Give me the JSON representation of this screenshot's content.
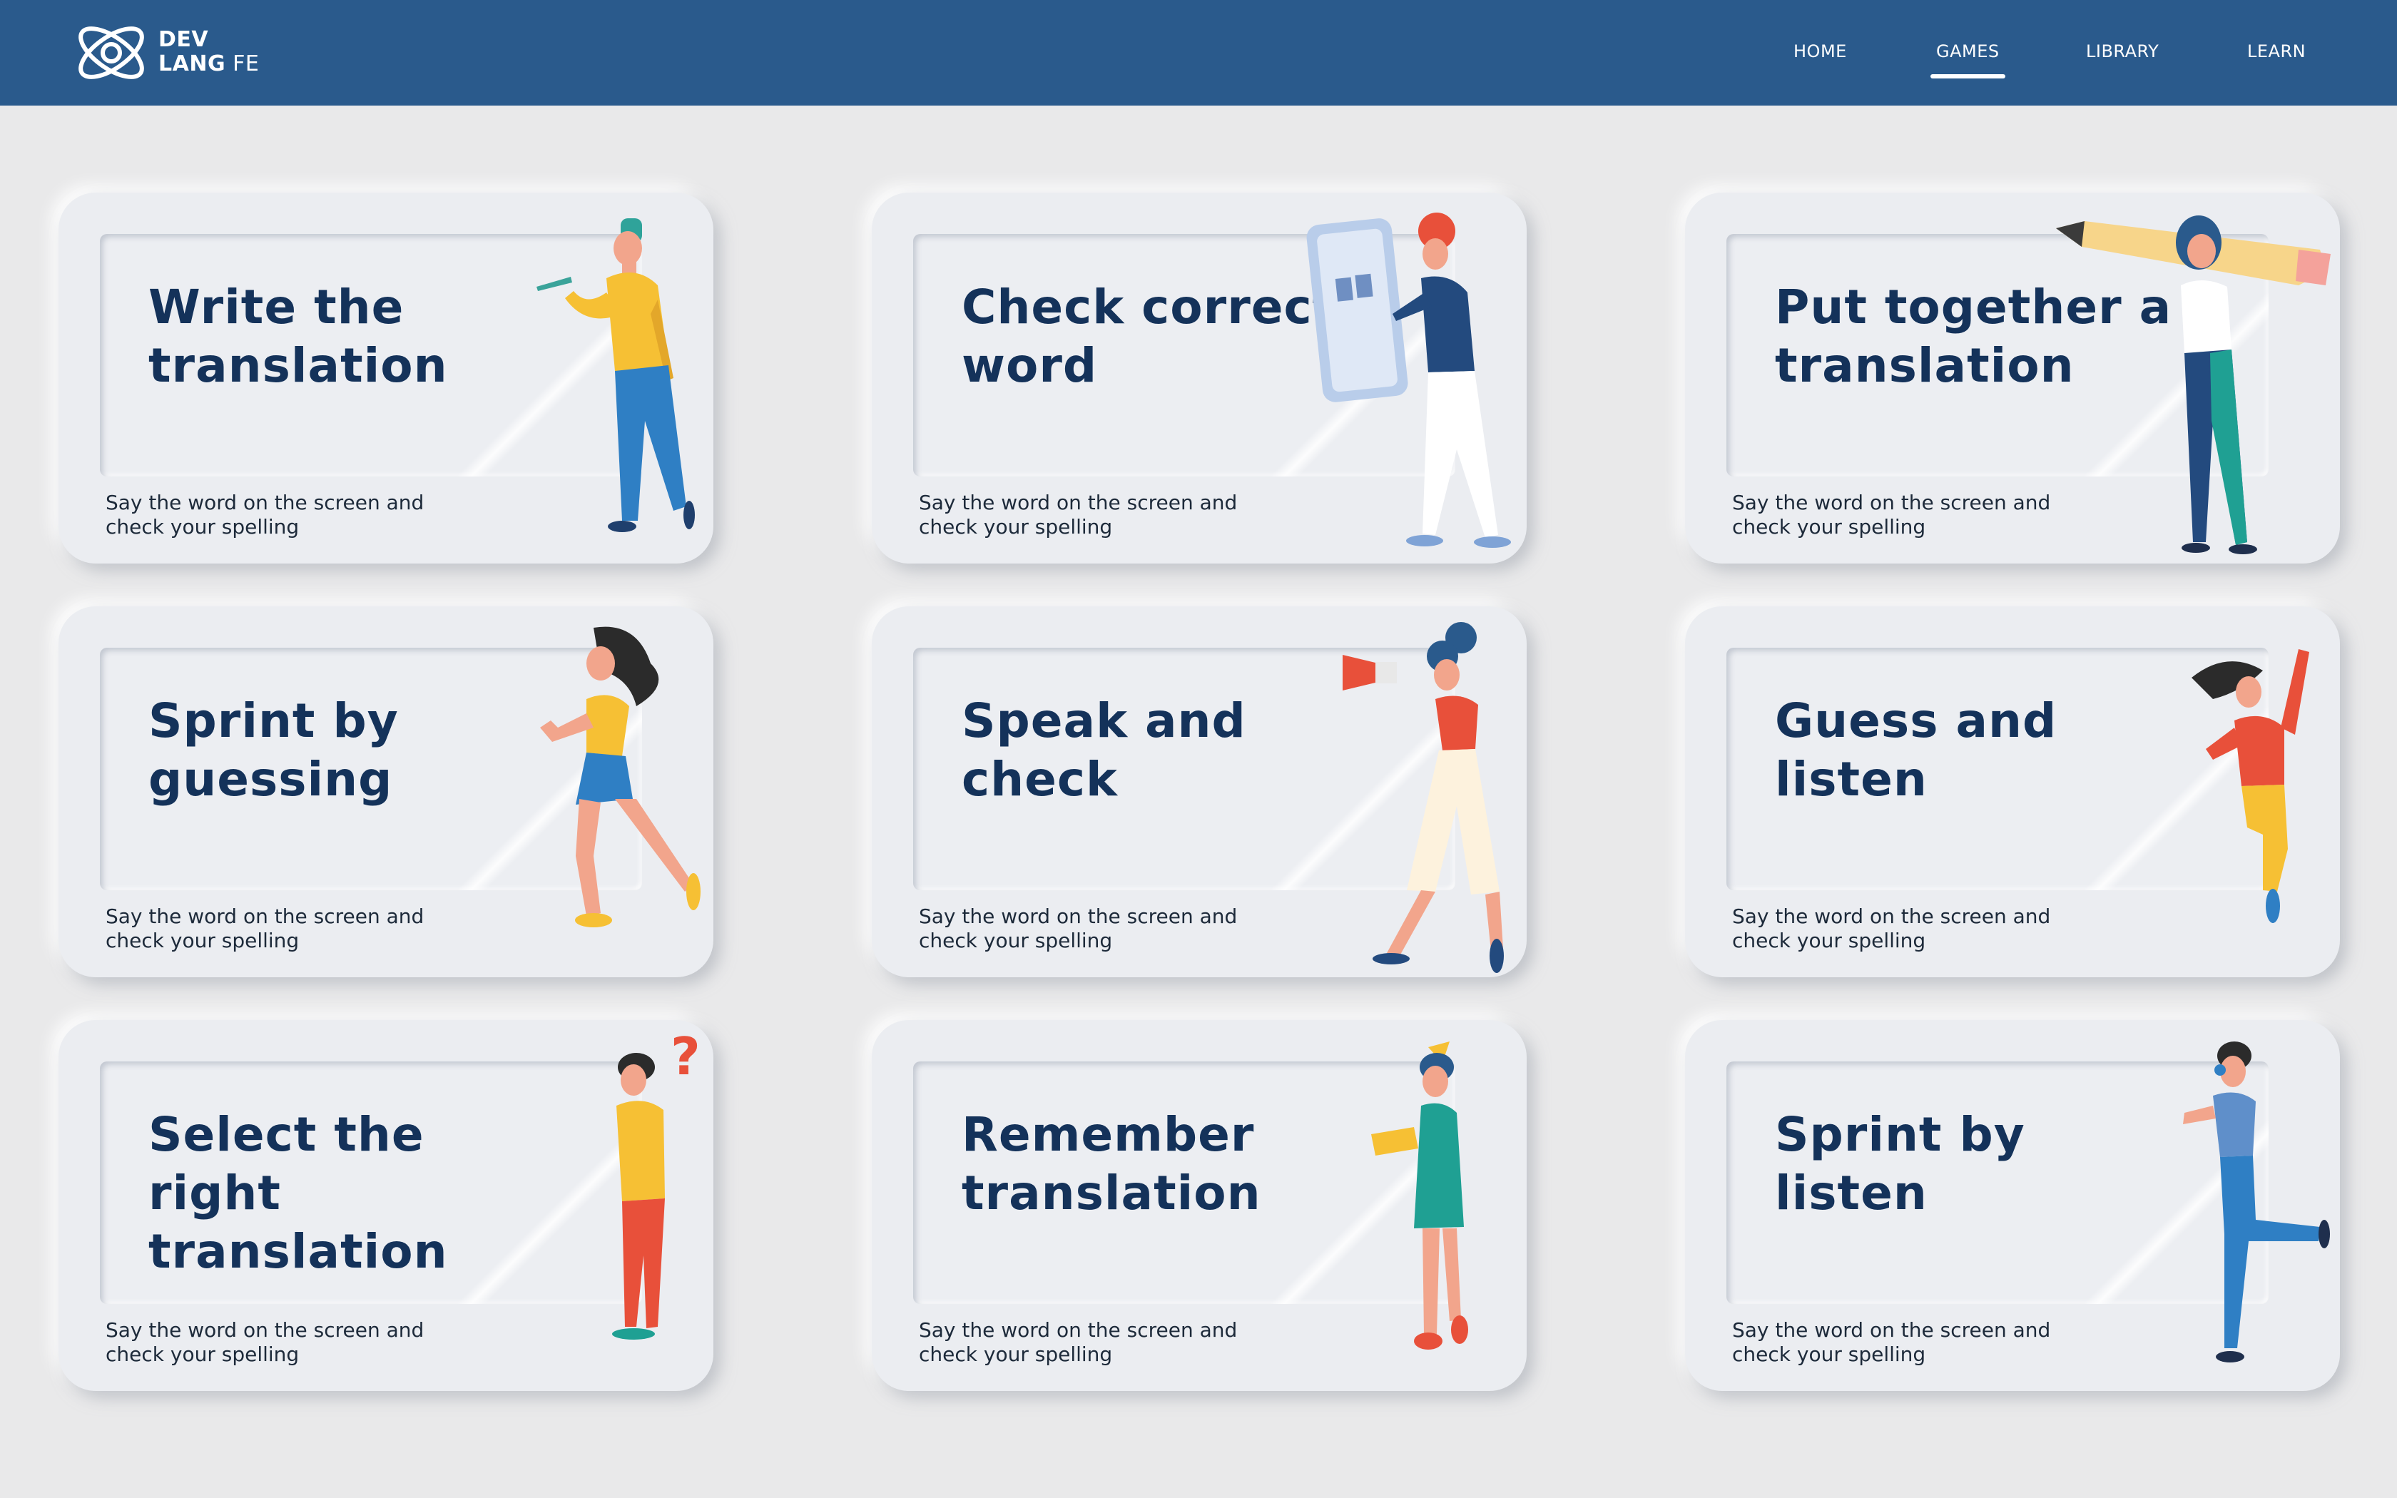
{
  "app": {
    "logo_line1": "DEV",
    "logo_line2_bold": "LANG",
    "logo_line2_rest": " FE"
  },
  "nav": {
    "items": [
      {
        "label": "HOME"
      },
      {
        "label": "GAMES"
      },
      {
        "label": "LIBRARY"
      },
      {
        "label": "LEARN"
      }
    ],
    "active": "GAMES"
  },
  "games": [
    {
      "title": "Write the translation",
      "subtitle": "Say the word on the screen and check your spelling"
    },
    {
      "title": "Check correct word",
      "subtitle": "Say the word on the screen and check your spelling"
    },
    {
      "title": "Put together a translation",
      "subtitle": "Say the word on the screen and check your spelling"
    },
    {
      "title": "Sprint by guessing",
      "subtitle": "Say the word on the screen and check your spelling"
    },
    {
      "title": "Speak and check",
      "subtitle": "Say the word on the screen and check your spelling"
    },
    {
      "title": "Guess and listen",
      "subtitle": "Say the word on the screen and check your spelling"
    },
    {
      "title": "Select the right translation",
      "subtitle": "Say the word on the screen and check your spelling"
    },
    {
      "title": "Remember translation",
      "subtitle": "Say the word on the screen and check your spelling"
    },
    {
      "title": "Sprint by listen",
      "subtitle": "Say the word on the screen and check your spelling"
    }
  ],
  "colors": {
    "header": "#2a5a8c",
    "background": "#e9e9ea",
    "card": "#ebedf1",
    "title": "#14325a"
  }
}
